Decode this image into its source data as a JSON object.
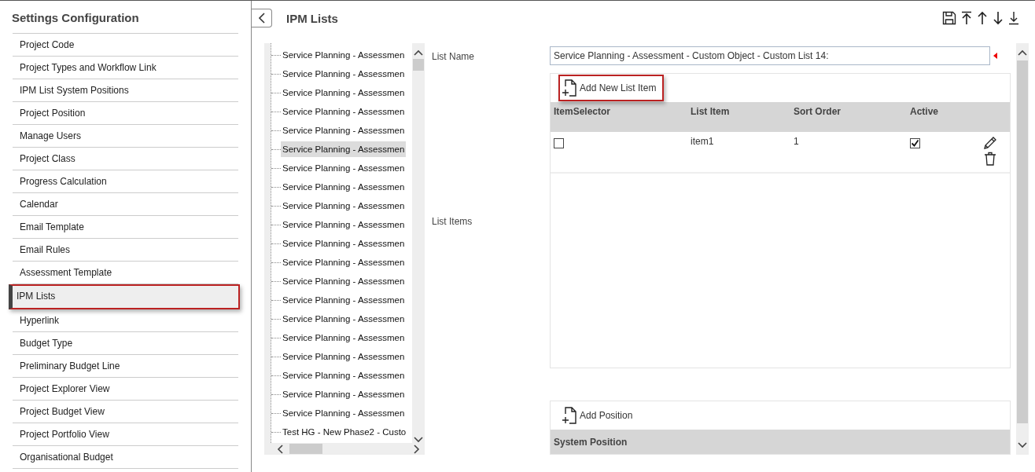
{
  "sidebar": {
    "title": "Settings Configuration",
    "items": [
      {
        "label": "Project Code",
        "selected": false
      },
      {
        "label": "Project Types and Workflow Link",
        "selected": false
      },
      {
        "label": "IPM List System Positions",
        "selected": false
      },
      {
        "label": "Project Position",
        "selected": false
      },
      {
        "label": "Manage Users",
        "selected": false
      },
      {
        "label": "Project Class",
        "selected": false
      },
      {
        "label": "Progress Calculation",
        "selected": false
      },
      {
        "label": "Calendar",
        "selected": false
      },
      {
        "label": "Email Template",
        "selected": false
      },
      {
        "label": "Email Rules",
        "selected": false
      },
      {
        "label": "Assessment Template",
        "selected": false
      },
      {
        "label": "IPM Lists",
        "selected": true
      },
      {
        "label": "Hyperlink",
        "selected": false
      },
      {
        "label": "Budget Type",
        "selected": false
      },
      {
        "label": "Preliminary Budget Line",
        "selected": false
      },
      {
        "label": "Project Explorer View",
        "selected": false
      },
      {
        "label": "Project Budget View",
        "selected": false
      },
      {
        "label": "Project Portfolio View",
        "selected": false
      },
      {
        "label": "Organisational Budget",
        "selected": false
      }
    ]
  },
  "header": {
    "title": "IPM Lists"
  },
  "tree": {
    "items": [
      {
        "label": "Service Planning - Assessmen",
        "selected": false
      },
      {
        "label": "Service Planning - Assessmen",
        "selected": false
      },
      {
        "label": "Service Planning - Assessmen",
        "selected": false
      },
      {
        "label": "Service Planning - Assessmen",
        "selected": false
      },
      {
        "label": "Service Planning - Assessmen",
        "selected": false
      },
      {
        "label": "Service Planning - Assessmen",
        "selected": true
      },
      {
        "label": "Service Planning - Assessmen",
        "selected": false
      },
      {
        "label": "Service Planning - Assessmen",
        "selected": false
      },
      {
        "label": "Service Planning - Assessmen",
        "selected": false
      },
      {
        "label": "Service Planning - Assessmen",
        "selected": false
      },
      {
        "label": "Service Planning - Assessmen",
        "selected": false
      },
      {
        "label": "Service Planning - Assessmen",
        "selected": false
      },
      {
        "label": "Service Planning - Assessmen",
        "selected": false
      },
      {
        "label": "Service Planning - Assessmen",
        "selected": false
      },
      {
        "label": "Service Planning - Assessmen",
        "selected": false
      },
      {
        "label": "Service Planning - Assessmen",
        "selected": false
      },
      {
        "label": "Service Planning - Assessmen",
        "selected": false
      },
      {
        "label": "Service Planning - Assessmen",
        "selected": false
      },
      {
        "label": "Service Planning - Assessmen",
        "selected": false
      },
      {
        "label": "Service Planning - Assessmen",
        "selected": false
      },
      {
        "label": "Test HG - New Phase2 - Custo",
        "selected": false
      }
    ]
  },
  "form": {
    "list_name": {
      "label": "List Name",
      "value": "Service Planning - Assessment - Custom Object - Custom List 14:"
    },
    "list_items": {
      "label": "List Items",
      "add_button": "Add New List Item",
      "columns": [
        "ItemSelector",
        "List Item",
        "Sort Order",
        "Active"
      ],
      "rows": [
        {
          "checked": false,
          "list_item": "item1",
          "sort_order": "1",
          "active": true
        }
      ]
    },
    "positions": {
      "add_button": "Add Position",
      "columns": [
        "System Position"
      ]
    }
  }
}
